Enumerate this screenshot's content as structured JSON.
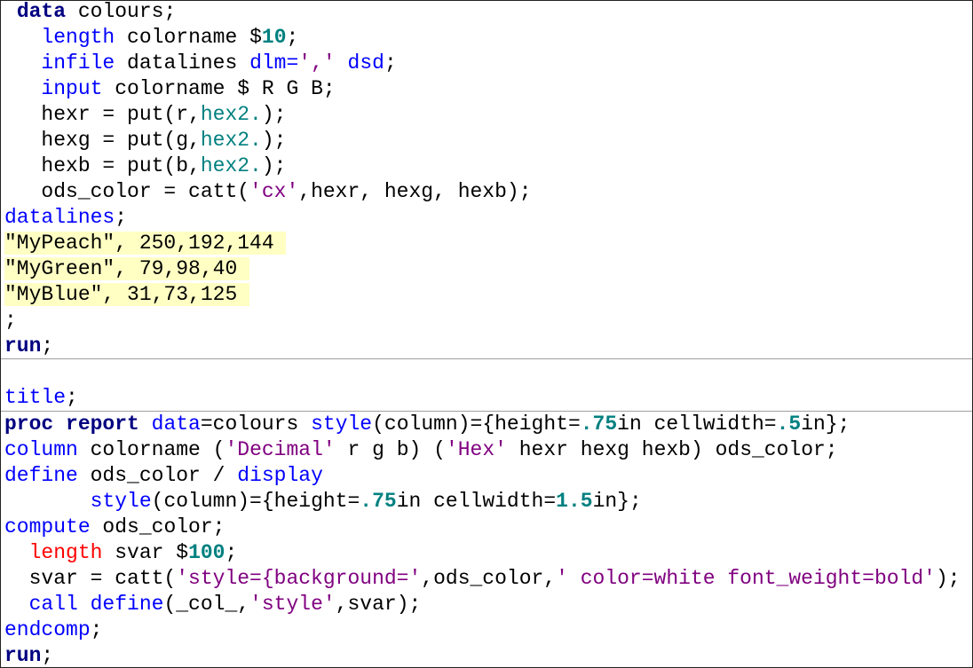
{
  "colors": {
    "keyword": "#000080",
    "statement": "#0000ff",
    "number": "#008080",
    "string": "#800080",
    "highlight": "#ffffc4",
    "error": "#ff0000"
  },
  "sections": [
    {
      "lines": [
        [
          [
            " ",
            ""
          ],
          [
            "data",
            "k"
          ],
          [
            " colours;",
            ""
          ]
        ],
        [
          [
            "   ",
            ""
          ],
          [
            "length",
            "b"
          ],
          [
            " colorname $",
            ""
          ],
          [
            "10",
            "n"
          ],
          [
            ";",
            ""
          ]
        ],
        [
          [
            "   ",
            ""
          ],
          [
            "infile",
            "b"
          ],
          [
            " datalines ",
            ""
          ],
          [
            "dlm=",
            "b"
          ],
          [
            "','",
            "s"
          ],
          [
            " ",
            ""
          ],
          [
            "dsd",
            "b"
          ],
          [
            ";",
            ""
          ]
        ],
        [
          [
            "   ",
            ""
          ],
          [
            "input",
            "b"
          ],
          [
            " colorname $ R G B;",
            ""
          ]
        ],
        [
          [
            "   hexr = put(r,",
            ""
          ],
          [
            "hex2.",
            "t"
          ],
          [
            ");",
            ""
          ]
        ],
        [
          [
            "   hexg = put(g,",
            ""
          ],
          [
            "hex2.",
            "t"
          ],
          [
            ");",
            ""
          ]
        ],
        [
          [
            "   hexb = put(b,",
            ""
          ],
          [
            "hex2.",
            "t"
          ],
          [
            ");",
            ""
          ]
        ],
        [
          [
            "   ods_color = catt(",
            ""
          ],
          [
            "'cx'",
            "s"
          ],
          [
            ",hexr, hexg, hexb);",
            ""
          ]
        ],
        [
          [
            "datalines",
            "b"
          ],
          [
            ";",
            ""
          ]
        ],
        [
          [
            "\"MyPeach\", 250,192,144 ",
            "hl"
          ]
        ],
        [
          [
            "\"MyGreen\", 79,98,40 ",
            "hl"
          ]
        ],
        [
          [
            "\"MyBlue\", 31,73,125 ",
            "hl"
          ]
        ],
        [
          [
            ";",
            ""
          ]
        ],
        [
          [
            "run",
            "k"
          ],
          [
            ";",
            ""
          ]
        ]
      ]
    },
    {
      "lines": [
        [
          [
            "",
            ""
          ]
        ],
        [
          [
            "title",
            "b"
          ],
          [
            ";",
            ""
          ]
        ]
      ]
    },
    {
      "lines": [
        [
          [
            "proc report",
            "k"
          ],
          [
            " ",
            ""
          ],
          [
            "data",
            "b"
          ],
          [
            "=colours ",
            ""
          ],
          [
            "style",
            "b"
          ],
          [
            "(column)={height=",
            ""
          ],
          [
            ".75",
            "n"
          ],
          [
            "in cellwidth=",
            ""
          ],
          [
            ".5",
            "n"
          ],
          [
            "in};",
            ""
          ]
        ],
        [
          [
            "column",
            "b"
          ],
          [
            " colorname (",
            ""
          ],
          [
            "'Decimal'",
            "s"
          ],
          [
            " r g b) (",
            ""
          ],
          [
            "'Hex'",
            "s"
          ],
          [
            " hexr hexg hexb) ods_color;",
            ""
          ]
        ],
        [
          [
            "define",
            "b"
          ],
          [
            " ods_color / ",
            ""
          ],
          [
            "display",
            "b"
          ]
        ],
        [
          [
            "       ",
            ""
          ],
          [
            "style",
            "b"
          ],
          [
            "(column)={height=",
            ""
          ],
          [
            ".75",
            "n"
          ],
          [
            "in cellwidth=",
            ""
          ],
          [
            "1.5",
            "n"
          ],
          [
            "in};",
            ""
          ]
        ],
        [
          [
            "compute",
            "b"
          ],
          [
            " ods_color;",
            ""
          ]
        ],
        [
          [
            "  ",
            ""
          ],
          [
            "length",
            "r"
          ],
          [
            " svar $",
            ""
          ],
          [
            "100",
            "n"
          ],
          [
            ";",
            ""
          ]
        ],
        [
          [
            "  svar = catt(",
            ""
          ],
          [
            "'style={background='",
            "s"
          ],
          [
            ",ods_color,",
            ""
          ],
          [
            "' color=white font_weight=bold'",
            "s"
          ],
          [
            ");",
            ""
          ]
        ],
        [
          [
            "  ",
            ""
          ],
          [
            "call define",
            "b"
          ],
          [
            "(_col_,",
            ""
          ],
          [
            "'style'",
            "s"
          ],
          [
            ",svar);",
            ""
          ]
        ],
        [
          [
            "endcomp",
            "b"
          ],
          [
            ";",
            ""
          ]
        ],
        [
          [
            "run",
            "k"
          ],
          [
            ";",
            ""
          ]
        ]
      ]
    }
  ]
}
